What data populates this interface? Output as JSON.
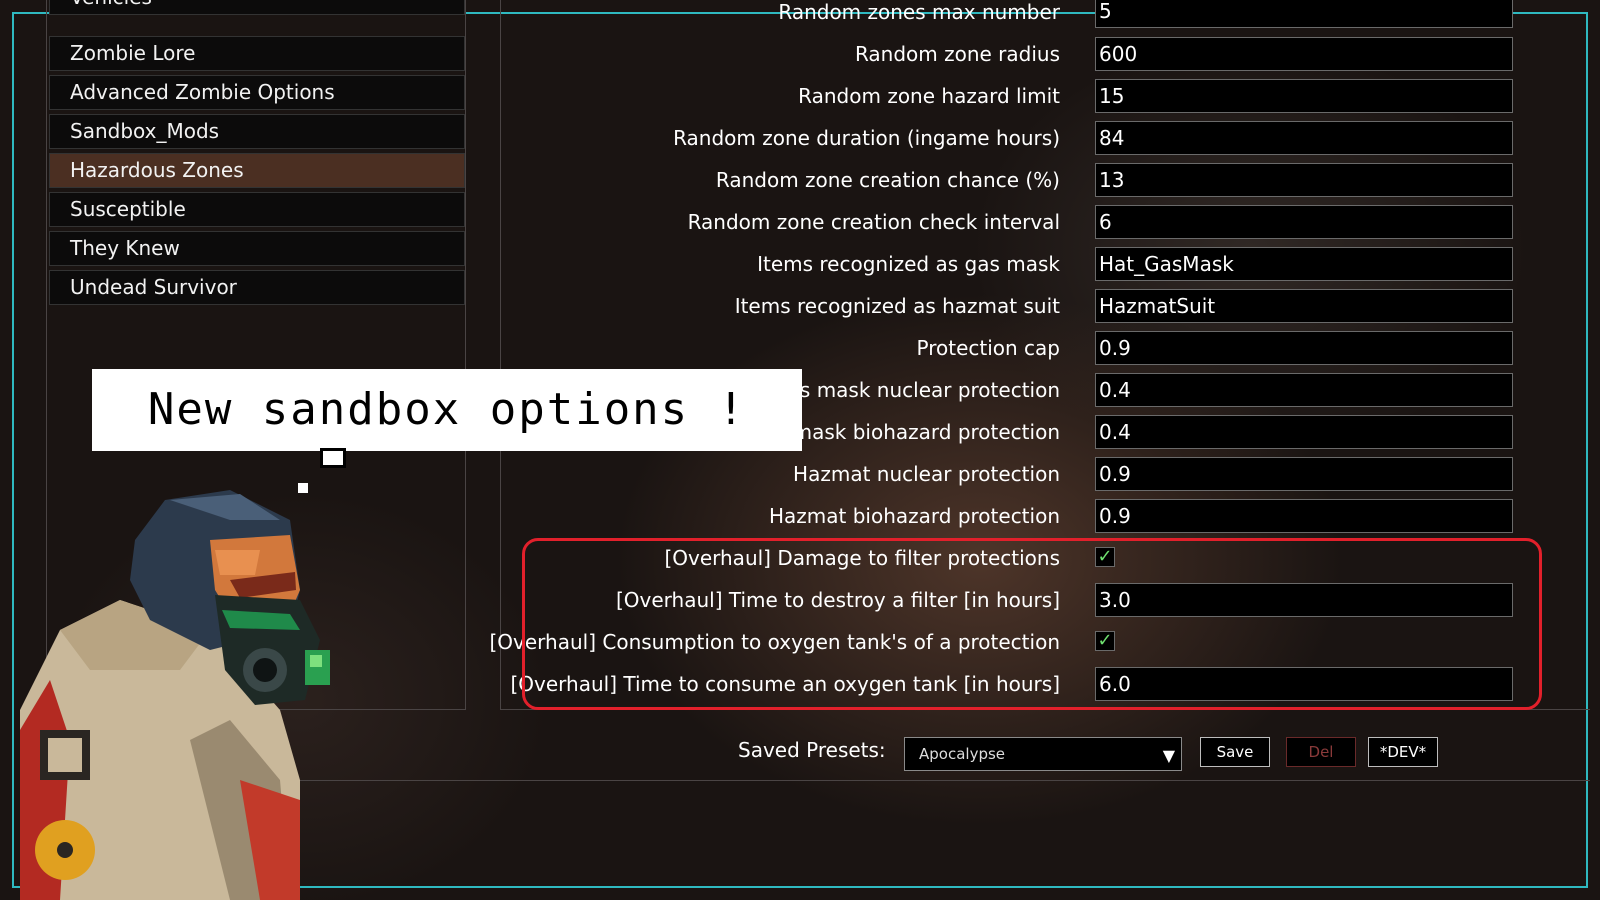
{
  "categories": [
    {
      "label": "Vehicles",
      "selected": false
    },
    {
      "label": "Zombie Lore",
      "selected": false
    },
    {
      "label": "Advanced Zombie Options",
      "selected": false
    },
    {
      "label": "Sandbox_Mods",
      "selected": false
    },
    {
      "label": "Hazardous Zones",
      "selected": true
    },
    {
      "label": "Susceptible",
      "selected": false
    },
    {
      "label": "They Knew",
      "selected": false
    },
    {
      "label": "Undead Survivor",
      "selected": false
    }
  ],
  "options": [
    {
      "label": "Random zones max number",
      "type": "text",
      "value": "5"
    },
    {
      "label": "Random zone radius",
      "type": "text",
      "value": "600"
    },
    {
      "label": "Random zone hazard limit",
      "type": "text",
      "value": "15"
    },
    {
      "label": "Random zone duration (ingame hours)",
      "type": "text",
      "value": "84"
    },
    {
      "label": "Random zone creation chance (%)",
      "type": "text",
      "value": "13"
    },
    {
      "label": "Random zone creation check interval",
      "type": "text",
      "value": "6"
    },
    {
      "label": "Items recognized as gas mask",
      "type": "text",
      "value": "Hat_GasMask"
    },
    {
      "label": "Items recognized as hazmat suit",
      "type": "text",
      "value": "HazmatSuit"
    },
    {
      "label": "Protection cap",
      "type": "text",
      "value": "0.9"
    },
    {
      "label": "Gas mask nuclear protection",
      "type": "text",
      "value": "0.4"
    },
    {
      "label": "Gas mask biohazard protection",
      "type": "text",
      "value": "0.4"
    },
    {
      "label": "Hazmat nuclear protection",
      "type": "text",
      "value": "0.9"
    },
    {
      "label": "Hazmat biohazard protection",
      "type": "text",
      "value": "0.9"
    },
    {
      "label": "[Overhaul] Damage to filter protections",
      "type": "checkbox",
      "checked": true,
      "check_glyph": "✓"
    },
    {
      "label": "[Overhaul] Time to destroy a filter [in hours]",
      "type": "text",
      "value": "3.0"
    },
    {
      "label": "[Overhaul] Consumption to oxygen tank's of a protection",
      "type": "checkbox",
      "checked": true,
      "check_glyph": "✓"
    },
    {
      "label": "[Overhaul] Time to consume an oxygen tank [in hours]",
      "type": "text",
      "value": "6.0"
    }
  ],
  "presets": {
    "label": "Saved Presets:",
    "selected": "Apocalypse",
    "arrow": "▼",
    "save_label": "Save",
    "del_label": "Del",
    "dev_label": "*DEV*"
  },
  "overlay": {
    "bubble_text": "New sandbox options !"
  },
  "colors": {
    "accent_frame": "#2fb9c0",
    "highlight": "#e2202b",
    "selected_category": "#4b2f22",
    "checkmark": "#6fe06f"
  }
}
